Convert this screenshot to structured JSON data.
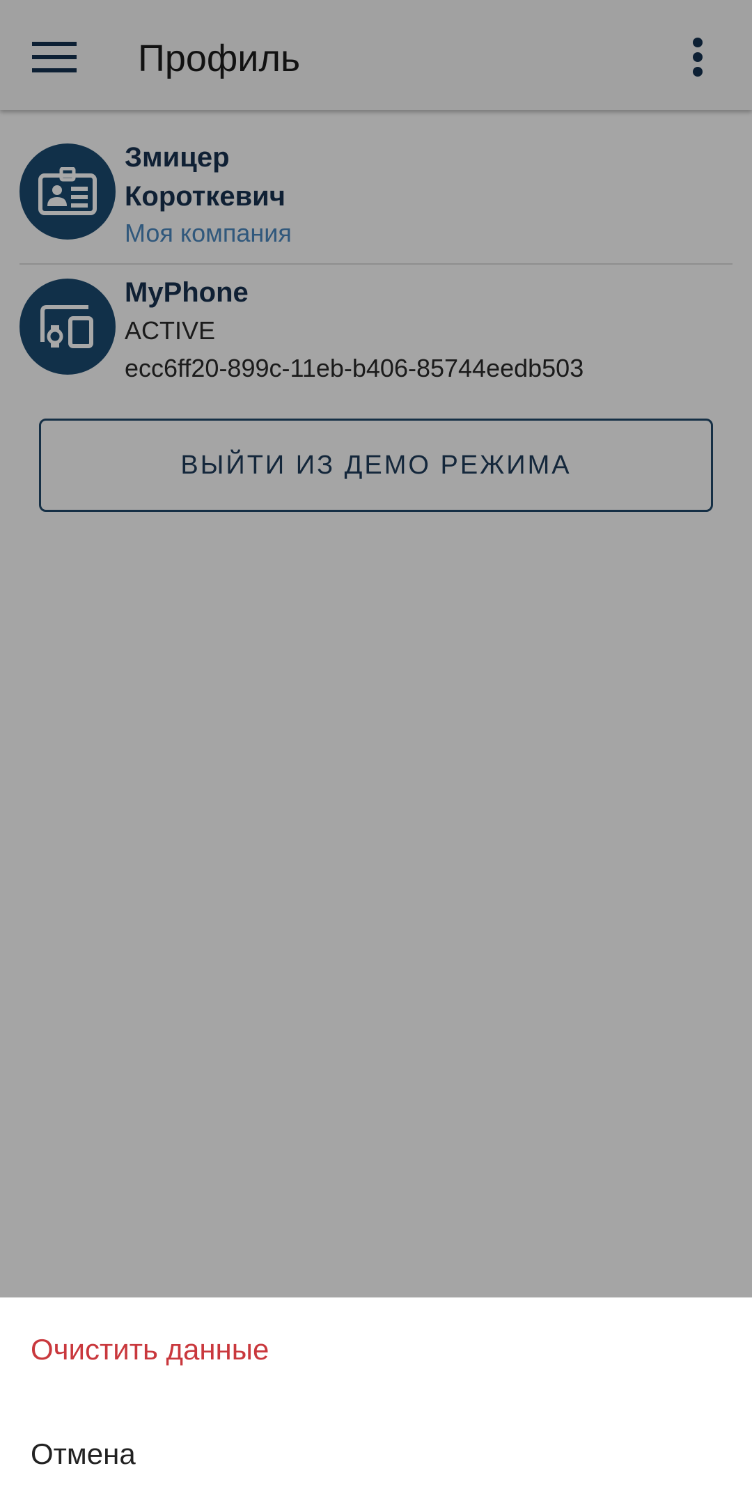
{
  "app_bar": {
    "title": "Профиль",
    "menu_icon": "hamburger-menu-icon",
    "overflow_icon": "more-vertical-icon"
  },
  "profile": {
    "first_name": "Змицер",
    "last_name": "Короткевич",
    "company": "Моя компания",
    "icon": "id-card-icon"
  },
  "device": {
    "name": "MyPhone",
    "status": "ACTIVE",
    "id": "ecc6ff20-899c-11eb-b406-85744eedb503",
    "icon": "devices-icon"
  },
  "exit_demo_label": "ВЫЙТИ ИЗ ДЕМО РЕЖИМА",
  "sheet": {
    "clear_data_label": "Очистить данные",
    "cancel_label": "Отмена"
  },
  "colors": {
    "accent_dark": "#1b4a70",
    "company_link": "#4a86bd",
    "danger": "#c9383d"
  }
}
